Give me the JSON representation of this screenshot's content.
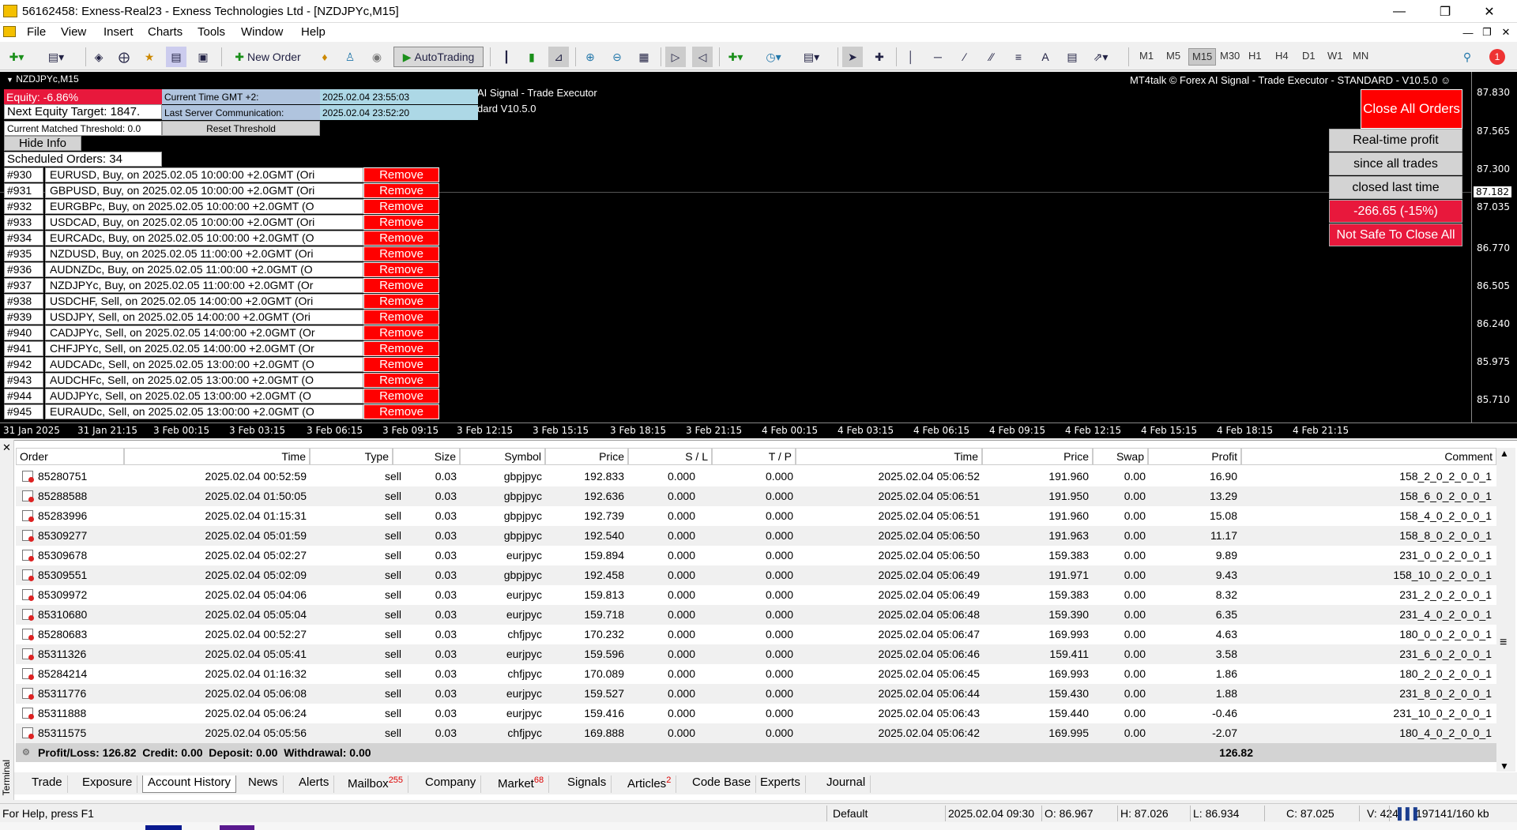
{
  "window": {
    "title": "56162458: Exness-Real23 - Exness Technologies Ltd - [NZDJPYc,M15]"
  },
  "menu": [
    "File",
    "View",
    "Insert",
    "Charts",
    "Tools",
    "Window",
    "Help"
  ],
  "toolbar": {
    "new_order": "New Order",
    "autotrading": "AutoTrading",
    "timeframes": [
      "M1",
      "M5",
      "M15",
      "M30",
      "H1",
      "H4",
      "D1",
      "W1",
      "MN"
    ],
    "active_tf": "M15",
    "notification_count": "1"
  },
  "chart": {
    "symbol_label": "NZDJPYc,M15",
    "watermark": "MT4talk © Forex AI Signal - Trade Executor - STANDARD - V10.5.0",
    "partial_text_1": "AI Signal - Trade Executor",
    "partial_text_2": "dard V10.5.0",
    "current_price": "87.182",
    "price_ticks": [
      "87.830",
      "87.565",
      "87.300",
      "87.035",
      "86.770",
      "86.505",
      "86.240",
      "85.975",
      "85.710"
    ],
    "time_ticks": [
      "31 Jan 2025",
      "31 Jan 21:15",
      "3 Feb 00:15",
      "3 Feb 03:15",
      "3 Feb 06:15",
      "3 Feb 09:15",
      "3 Feb 12:15",
      "3 Feb 15:15",
      "3 Feb 18:15",
      "3 Feb 21:15",
      "4 Feb 00:15",
      "4 Feb 03:15",
      "4 Feb 06:15",
      "4 Feb 09:15",
      "4 Feb 12:15",
      "4 Feb 15:15",
      "4 Feb 18:15",
      "4 Feb 21:15"
    ]
  },
  "panel": {
    "equity": "Equity: -6.86%",
    "next_equity_target": "Next Equity Target: 1847.",
    "matched_threshold": "Current Matched Threshold: 0.0",
    "current_time_label": "Current Time GMT +2:",
    "current_time_value": "2025.02.04 23:55:03",
    "server_comm_label": "Last Server Communication:",
    "server_comm_value": "2025.02.04 23:52:20",
    "reset_threshold": "Reset Threshold",
    "hide_info": "Hide Info",
    "scheduled_orders": "Scheduled Orders: 34",
    "remove_label": "Remove"
  },
  "scheduled": [
    {
      "num": "#930",
      "desc": "EURUSD, Buy, on 2025.02.05 10:00:00 +2.0GMT  (Ori"
    },
    {
      "num": "#931",
      "desc": "GBPUSD, Buy, on 2025.02.05 10:00:00 +2.0GMT  (Ori"
    },
    {
      "num": "#932",
      "desc": "EURGBPc, Buy, on 2025.02.05 10:00:00 +2.0GMT  (O"
    },
    {
      "num": "#933",
      "desc": "USDCAD, Buy, on 2025.02.05 10:00:00 +2.0GMT  (Ori"
    },
    {
      "num": "#934",
      "desc": "EURCADc, Buy, on 2025.02.05 10:00:00 +2.0GMT  (O"
    },
    {
      "num": "#935",
      "desc": "NZDUSD, Buy, on 2025.02.05 11:00:00 +2.0GMT  (Ori"
    },
    {
      "num": "#936",
      "desc": "AUDNZDc, Buy, on 2025.02.05 11:00:00 +2.0GMT  (O"
    },
    {
      "num": "#937",
      "desc": "NZDJPYc, Buy, on 2025.02.05 11:00:00 +2.0GMT  (Or"
    },
    {
      "num": "#938",
      "desc": "USDCHF, Sell, on 2025.02.05 14:00:00 +2.0GMT  (Ori"
    },
    {
      "num": "#939",
      "desc": "USDJPY, Sell, on 2025.02.05 14:00:00 +2.0GMT  (Ori"
    },
    {
      "num": "#940",
      "desc": "CADJPYc, Sell, on 2025.02.05 14:00:00 +2.0GMT  (Or"
    },
    {
      "num": "#941",
      "desc": "CHFJPYc, Sell, on 2025.02.05 14:00:00 +2.0GMT  (Or"
    },
    {
      "num": "#942",
      "desc": "AUDCADc, Sell, on 2025.02.05 13:00:00 +2.0GMT  (O"
    },
    {
      "num": "#943",
      "desc": "AUDCHFc, Sell, on 2025.02.05 13:00:00 +2.0GMT  (O"
    },
    {
      "num": "#944",
      "desc": "AUDJPYc, Sell, on 2025.02.05 13:00:00 +2.0GMT  (O"
    },
    {
      "num": "#945",
      "desc": "EURAUDc, Sell, on 2025.02.05 13:00:00 +2.0GMT  (O"
    }
  ],
  "right_panel": {
    "close_all": "Close All Orders",
    "realtime_profit": "Real-time profit",
    "since_all_trades": "since all trades",
    "closed_last_time": "closed last time",
    "profit_value": "-266.65 (-15%)",
    "not_safe": "Not Safe To Close All"
  },
  "table": {
    "headers": [
      "Order",
      "Time",
      "Type",
      "Size",
      "Symbol",
      "Price",
      "S / L",
      "T / P",
      "Time",
      "Price",
      "Swap",
      "Profit",
      "Comment"
    ],
    "rows": [
      [
        "85280751",
        "2025.02.04 00:52:59",
        "sell",
        "0.03",
        "gbpjpyc",
        "192.833",
        "0.000",
        "0.000",
        "2025.02.04 05:06:52",
        "191.960",
        "0.00",
        "16.90",
        "158_2_0_2_0_0_1"
      ],
      [
        "85288588",
        "2025.02.04 01:50:05",
        "sell",
        "0.03",
        "gbpjpyc",
        "192.636",
        "0.000",
        "0.000",
        "2025.02.04 05:06:51",
        "191.950",
        "0.00",
        "13.29",
        "158_6_0_2_0_0_1"
      ],
      [
        "85283996",
        "2025.02.04 01:15:31",
        "sell",
        "0.03",
        "gbpjpyc",
        "192.739",
        "0.000",
        "0.000",
        "2025.02.04 05:06:51",
        "191.960",
        "0.00",
        "15.08",
        "158_4_0_2_0_0_1"
      ],
      [
        "85309277",
        "2025.02.04 05:01:59",
        "sell",
        "0.03",
        "gbpjpyc",
        "192.540",
        "0.000",
        "0.000",
        "2025.02.04 05:06:50",
        "191.963",
        "0.00",
        "11.17",
        "158_8_0_2_0_0_1"
      ],
      [
        "85309678",
        "2025.02.04 05:02:27",
        "sell",
        "0.03",
        "eurjpyc",
        "159.894",
        "0.000",
        "0.000",
        "2025.02.04 05:06:50",
        "159.383",
        "0.00",
        "9.89",
        "231_0_0_2_0_0_1"
      ],
      [
        "85309551",
        "2025.02.04 05:02:09",
        "sell",
        "0.03",
        "gbpjpyc",
        "192.458",
        "0.000",
        "0.000",
        "2025.02.04 05:06:49",
        "191.971",
        "0.00",
        "9.43",
        "158_10_0_2_0_0_1"
      ],
      [
        "85309972",
        "2025.02.04 05:04:06",
        "sell",
        "0.03",
        "eurjpyc",
        "159.813",
        "0.000",
        "0.000",
        "2025.02.04 05:06:49",
        "159.383",
        "0.00",
        "8.32",
        "231_2_0_2_0_0_1"
      ],
      [
        "85310680",
        "2025.02.04 05:05:04",
        "sell",
        "0.03",
        "eurjpyc",
        "159.718",
        "0.000",
        "0.000",
        "2025.02.04 05:06:48",
        "159.390",
        "0.00",
        "6.35",
        "231_4_0_2_0_0_1"
      ],
      [
        "85280683",
        "2025.02.04 00:52:27",
        "sell",
        "0.03",
        "chfjpyc",
        "170.232",
        "0.000",
        "0.000",
        "2025.02.04 05:06:47",
        "169.993",
        "0.00",
        "4.63",
        "180_0_0_2_0_0_1"
      ],
      [
        "85311326",
        "2025.02.04 05:05:41",
        "sell",
        "0.03",
        "eurjpyc",
        "159.596",
        "0.000",
        "0.000",
        "2025.02.04 05:06:46",
        "159.411",
        "0.00",
        "3.58",
        "231_6_0_2_0_0_1"
      ],
      [
        "85284214",
        "2025.02.04 01:16:32",
        "sell",
        "0.03",
        "chfjpyc",
        "170.089",
        "0.000",
        "0.000",
        "2025.02.04 05:06:45",
        "169.993",
        "0.00",
        "1.86",
        "180_2_0_2_0_0_1"
      ],
      [
        "85311776",
        "2025.02.04 05:06:08",
        "sell",
        "0.03",
        "eurjpyc",
        "159.527",
        "0.000",
        "0.000",
        "2025.02.04 05:06:44",
        "159.430",
        "0.00",
        "1.88",
        "231_8_0_2_0_0_1"
      ],
      [
        "85311888",
        "2025.02.04 05:06:24",
        "sell",
        "0.03",
        "eurjpyc",
        "159.416",
        "0.000",
        "0.000",
        "2025.02.04 05:06:43",
        "159.440",
        "0.00",
        "-0.46",
        "231_10_0_2_0_0_1"
      ],
      [
        "85311575",
        "2025.02.04 05:05:56",
        "sell",
        "0.03",
        "chfjpyc",
        "169.888",
        "0.000",
        "0.000",
        "2025.02.04 05:06:42",
        "169.995",
        "0.00",
        "-2.07",
        "180_4_0_2_0_0_1"
      ]
    ],
    "summary": "Profit/Loss: 126.82  Credit: 0.00  Deposit: 0.00  Withdrawal: 0.00",
    "summary_total": "126.82"
  },
  "tabs": [
    {
      "label": "Trade"
    },
    {
      "label": "Exposure"
    },
    {
      "label": "Account History",
      "active": true
    },
    {
      "label": "News"
    },
    {
      "label": "Alerts"
    },
    {
      "label": "Mailbox",
      "badge": "255"
    },
    {
      "label": "Company"
    },
    {
      "label": "Market",
      "badge": "68"
    },
    {
      "label": "Signals"
    },
    {
      "label": "Articles",
      "badge": "2"
    },
    {
      "label": "Code Base"
    },
    {
      "label": "Experts"
    },
    {
      "label": "Journal"
    }
  ],
  "terminal_label": "Terminal",
  "statusbar": {
    "help": "For Help, press F1",
    "profile": "Default",
    "datetime": "2025.02.04 09:30",
    "open": "O: 86.967",
    "high": "H: 87.026",
    "low": "L: 86.934",
    "close": "C: 87.025",
    "volume": "V: 424",
    "memory": "197141/160 kb"
  },
  "colors": {
    "equity_bg": "#e8183c",
    "info_blue": "#add8e6",
    "remove_red": "#ff0000",
    "chart_bg": "#000000"
  }
}
